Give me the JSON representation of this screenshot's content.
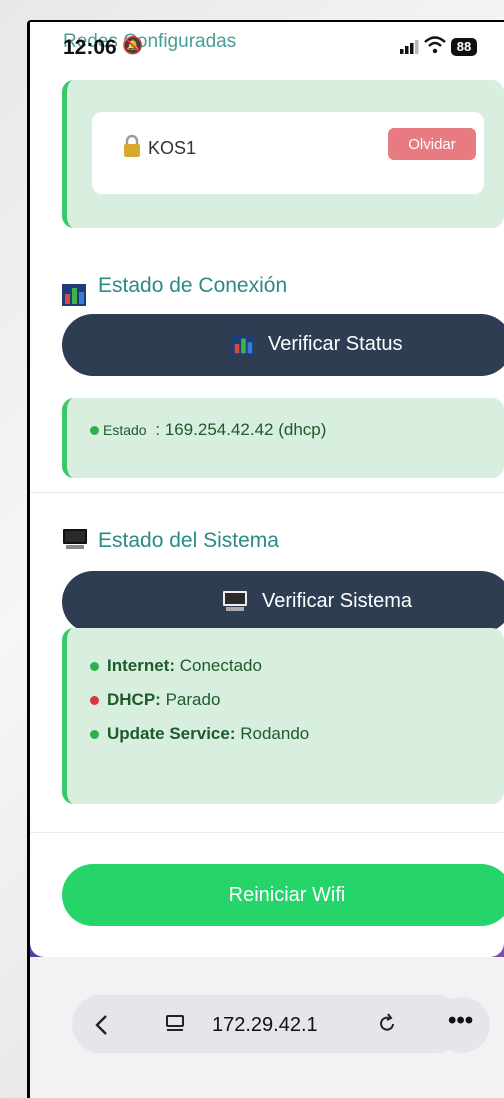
{
  "status_bar": {
    "time": "12:06",
    "battery": "88"
  },
  "top_heading": "Redes Configuradas",
  "saved_network": {
    "name": "KOS1",
    "forget_label": "Olvidar"
  },
  "connection": {
    "title": "Estado de Conexión",
    "button_label": "Verificar Status",
    "status_label": "Estado",
    "status_value": ": 169.254.42.42 (dhcp)"
  },
  "system": {
    "title": "Estado del Sistema",
    "button_label": "Verificar Sistema",
    "items": [
      {
        "name": "Internet:",
        "value": "Conectado",
        "color": "#2bb24c"
      },
      {
        "name": "DHCP:",
        "value": "Parado",
        "color": "#d9363e"
      },
      {
        "name": "Update Service:",
        "value": "Rodando",
        "color": "#2bb24c"
      }
    ]
  },
  "restart_button": "Reiniciar Wifi",
  "browser": {
    "url": "172.29.42.1"
  }
}
